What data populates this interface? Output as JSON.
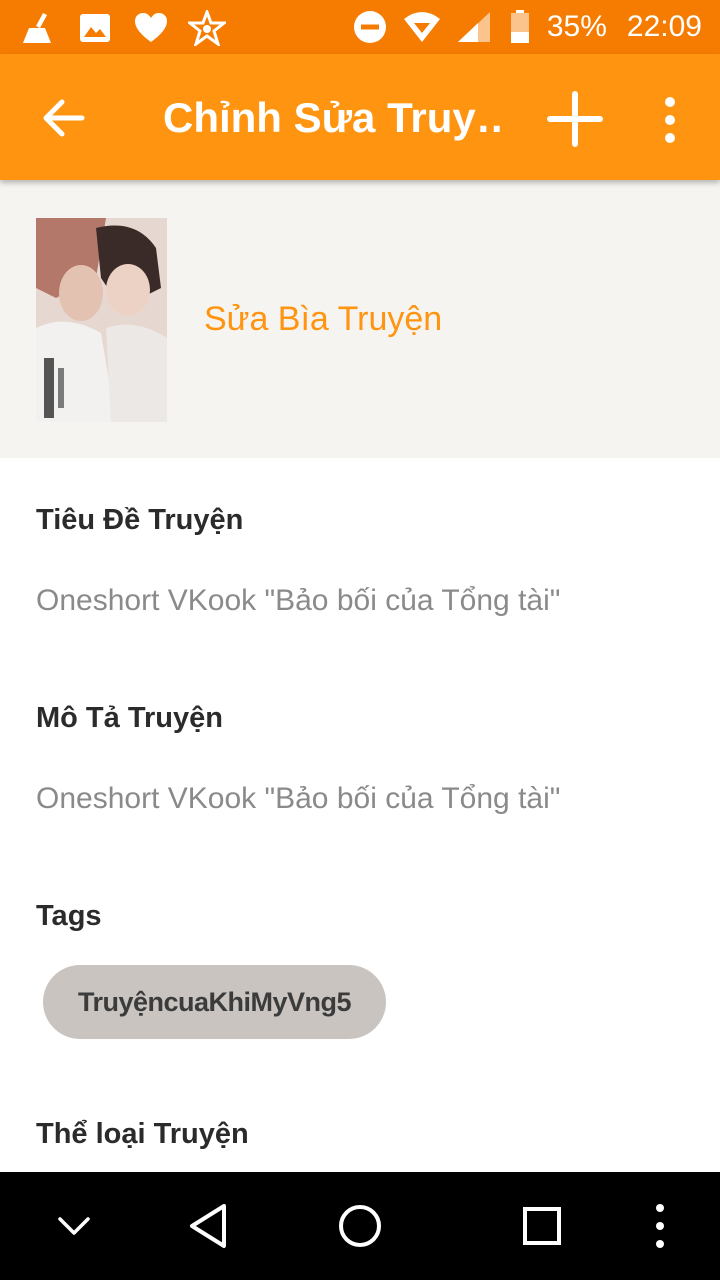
{
  "status_bar": {
    "icons": [
      "broom-icon",
      "image-icon",
      "heart-icon",
      "star-badge-icon",
      "do-not-disturb-icon",
      "wifi-icon",
      "signal-icon",
      "battery-icon"
    ],
    "battery": "35%",
    "time": "22:09"
  },
  "app_bar": {
    "title": "Chỉnh Sửa Truy…",
    "back_icon": "arrow-back-icon",
    "add_icon": "plus-icon",
    "more_icon": "more-vertical-icon"
  },
  "cover": {
    "edit_label": "Sửa Bìa Truyện"
  },
  "form": {
    "title_label": "Tiêu Đề Truyện",
    "title_value": "Oneshort VKook \"Bảo bối của Tổng tài\"",
    "description_label": "Mô Tả Truyện",
    "description_value": "Oneshort VKook \"Bảo bối của Tổng tài\"",
    "tags_label": "Tags",
    "tags": [
      "TruyệncuaKhiMyVng5"
    ],
    "genre_label": "Thể loại Truyện"
  },
  "nav_bar": {
    "icons": [
      "chevron-down-icon",
      "back-triangle-icon",
      "home-circle-icon",
      "recents-square-icon",
      "more-vertical-icon"
    ]
  },
  "colors": {
    "status_bar": "#f57c00",
    "app_bar": "#ff9411",
    "accent": "#ff9411",
    "cover_bg": "#f6f4f1",
    "tag_chip": "#c9c4c0"
  }
}
